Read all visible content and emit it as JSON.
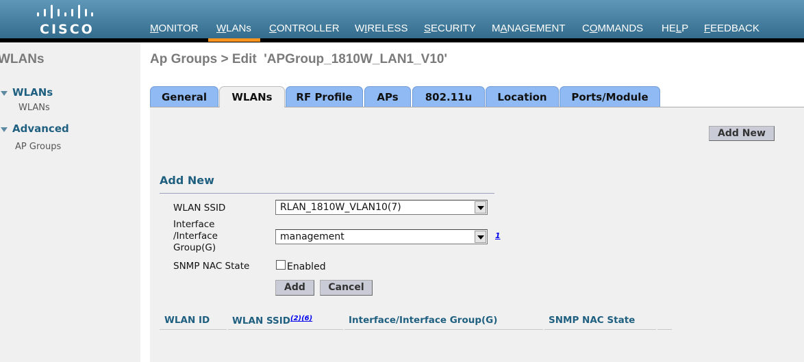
{
  "header": {
    "logo_text": "CISCO",
    "nav": [
      {
        "pre": "",
        "key": "M",
        "post": "ONITOR"
      },
      {
        "pre": "",
        "key": "W",
        "post": "LANs",
        "active": true
      },
      {
        "pre": "",
        "key": "C",
        "post": "ONTROLLER"
      },
      {
        "pre": "W",
        "key": "I",
        "post": "RELESS"
      },
      {
        "pre": "",
        "key": "S",
        "post": "ECURITY"
      },
      {
        "pre": "M",
        "key": "A",
        "post": "NAGEMENT"
      },
      {
        "pre": "C",
        "key": "O",
        "post": "MMANDS"
      },
      {
        "pre": "HE",
        "key": "L",
        "post": "P"
      },
      {
        "pre": "",
        "key": "F",
        "post": "EEDBACK"
      }
    ],
    "accent": "#f7941d"
  },
  "sidebar": {
    "title": "WLANs",
    "groups": [
      {
        "label": "WLANs",
        "items": [
          "WLANs"
        ]
      },
      {
        "label": "Advanced",
        "items": [
          "AP Groups"
        ]
      }
    ]
  },
  "page": {
    "title": "Ap Groups > Edit  'APGroup_1810W_LAN1_V10'",
    "tabs": [
      "General",
      "WLANs",
      "RF Profile",
      "APs",
      "802.11u",
      "Location",
      "Ports/Module"
    ],
    "active_tab": "WLANs",
    "add_new_button": "Add New"
  },
  "form": {
    "heading": "Add New",
    "ssid_label": "WLAN SSID",
    "ssid_value": "RLAN_1810W_VLAN10(7)",
    "iface_label_lines": [
      "Interface",
      "/Interface",
      "Group(G)"
    ],
    "iface_value": "management",
    "iface_footnote": "1",
    "snmp_label": "SNMP NAC State",
    "snmp_option": "Enabled",
    "snmp_checked": false,
    "add_button": "Add",
    "cancel_button": "Cancel"
  },
  "table": {
    "columns": [
      "WLAN ID",
      "WLAN SSID",
      "Interface/Interface Group(G)",
      "SNMP NAC State"
    ],
    "ssid_footnotes": "(2)(6)"
  }
}
